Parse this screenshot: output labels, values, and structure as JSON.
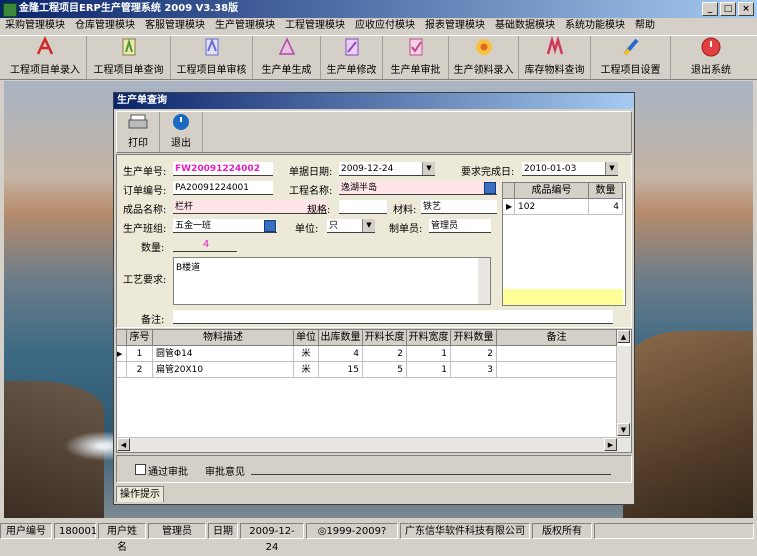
{
  "app": {
    "title": "金隆工程项目ERP生产管理系统 2009 V3.38版"
  },
  "menu": [
    "采购管理模块",
    "仓库管理模块",
    "客服管理模块",
    "生产管理模块",
    "工程管理模块",
    "应收应付模块",
    "报表管理模块",
    "基础数据模块",
    "系统功能模块",
    "帮助"
  ],
  "toolbar": [
    {
      "label": "工程项目单录入",
      "icon": "pdf-icon",
      "color": "#d02828"
    },
    {
      "label": "工程项目单查询",
      "icon": "query-icon",
      "color": "#4a9a3a"
    },
    {
      "label": "工程项目单审核",
      "icon": "audit-icon",
      "color": "#6a6ad0"
    },
    {
      "label": "生产单生成",
      "icon": "generate-icon",
      "color": "#b04aa0"
    },
    {
      "label": "生产单修改",
      "icon": "edit-icon",
      "color": "#8a4ac0"
    },
    {
      "label": "生产单审批",
      "icon": "approve-icon",
      "color": "#c04a8a"
    },
    {
      "label": "生产领料录入",
      "icon": "flower-icon",
      "color": "#e8a020"
    },
    {
      "label": "库存物料查询",
      "icon": "stock-icon",
      "color": "#d03a5a"
    },
    {
      "label": "工程项目设置",
      "icon": "settings-icon",
      "color": "#2a6ad0"
    },
    {
      "label": "退出系统",
      "icon": "power-icon",
      "color": "#e04040"
    }
  ],
  "child": {
    "title": "生产单查询",
    "print_label": "打印",
    "exit_label": "退出",
    "labels": {
      "prod_no": "生产单号:",
      "doc_date": "单据日期:",
      "due_date": "要求完成日:",
      "order_no": "订单编号:",
      "project": "工程名称:",
      "product": "成品名称:",
      "spec": "规格:",
      "material": "材料:",
      "team": "生产班组:",
      "unit": "单位:",
      "maker": "制单员:",
      "qty": "数量:",
      "craft": "工艺要求:",
      "remark": "备注:"
    },
    "values": {
      "prod_no": "FW20091224002",
      "doc_date": "2009-12-24",
      "due_date": "2010-01-03",
      "order_no": "PA20091224001",
      "project": "逸湖半岛",
      "product": "栏杆",
      "spec": "",
      "material": "铁艺",
      "team": "五金一班",
      "unit": "只",
      "maker": "管理员",
      "qty": "4",
      "craft": "B楼道",
      "remark": ""
    },
    "side_grid": {
      "headers": [
        "成品编号",
        "数量"
      ],
      "rows": [
        {
          "code": "102",
          "qty": "4"
        }
      ]
    },
    "grid": {
      "headers": [
        "序号",
        "物料描述",
        "单位",
        "出库数量",
        "开料长度",
        "开料宽度",
        "开料数量",
        "备注"
      ],
      "rows": [
        {
          "no": "1",
          "desc": "圆管Φ14",
          "unit": "米",
          "out": "4",
          "len": "2",
          "wid": "1",
          "cnt": "2",
          "remark": ""
        },
        {
          "no": "2",
          "desc": "扁管20X10",
          "unit": "米",
          "out": "15",
          "len": "5",
          "wid": "1",
          "cnt": "3",
          "remark": ""
        }
      ]
    },
    "approve": {
      "check_label": "通过审批",
      "opinion_label": "审批意见",
      "opinion": ""
    },
    "tab_label": "操作提示"
  },
  "status": {
    "user_no_label": "用户编号",
    "user_no": "180001",
    "user_name_label": "用户姓名",
    "user_name": "管理员",
    "date_label": "日期",
    "date": "2009-12-24",
    "copyright": "◎1999-2009?",
    "company": "广东信华软件科技有限公司",
    "rights": "版权所有"
  }
}
